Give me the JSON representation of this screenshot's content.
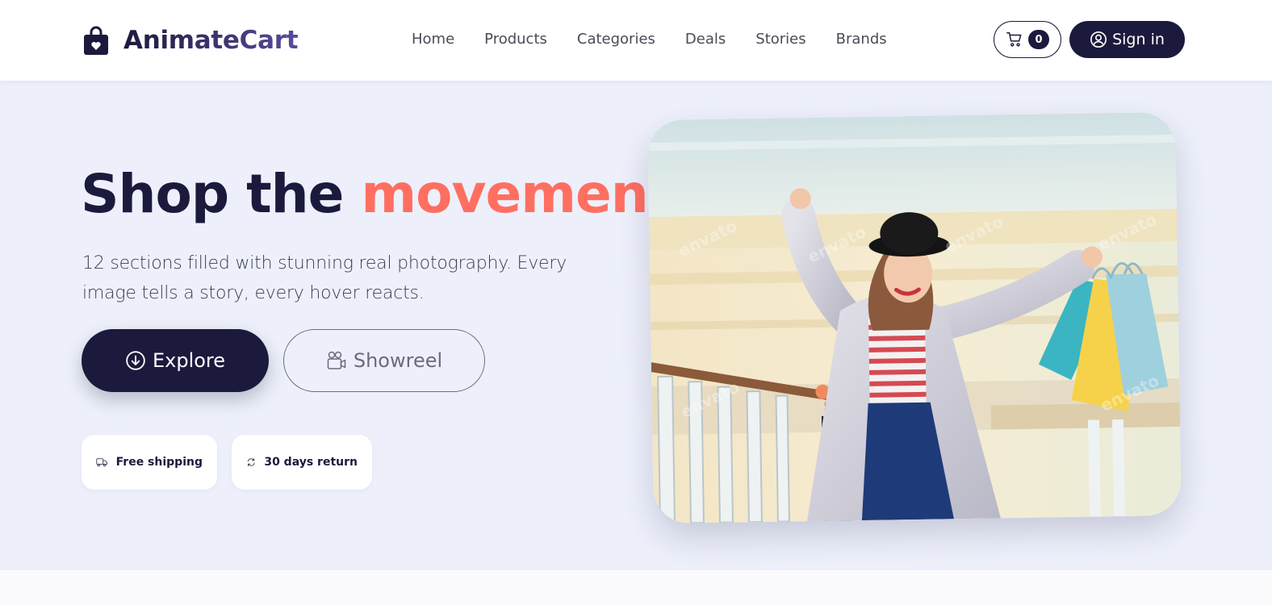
{
  "brand": {
    "name": "AnimateCart",
    "icon": "shopping-bag-heart-icon"
  },
  "nav": {
    "links": [
      "Home",
      "Products",
      "Categories",
      "Deals",
      "Stories",
      "Brands"
    ]
  },
  "cart": {
    "icon": "cart-icon",
    "count": "0"
  },
  "signin": {
    "label": "Sign in",
    "icon": "user-circle-icon"
  },
  "hero": {
    "title_start": "Shop the ",
    "title_accent": "movement",
    "subtitle": "12 sections filled with stunning real photography. Every image tells a story, every hover reacts.",
    "explore_label": "Explore",
    "explore_icon": "arrow-down-circle-icon",
    "showreel_label": "Showreel",
    "showreel_icon": "camera-reels-icon",
    "badges": [
      {
        "label": "Free shipping",
        "icon": "truck-icon"
      },
      {
        "label": "30 days return",
        "icon": "arrow-repeat-icon"
      }
    ],
    "image_watermark": "envato"
  },
  "colors": {
    "primary": "#1b1a3d",
    "accent": "#ff6f61",
    "hero_bg": "#edf0fa",
    "muted": "#6b6b7e"
  }
}
